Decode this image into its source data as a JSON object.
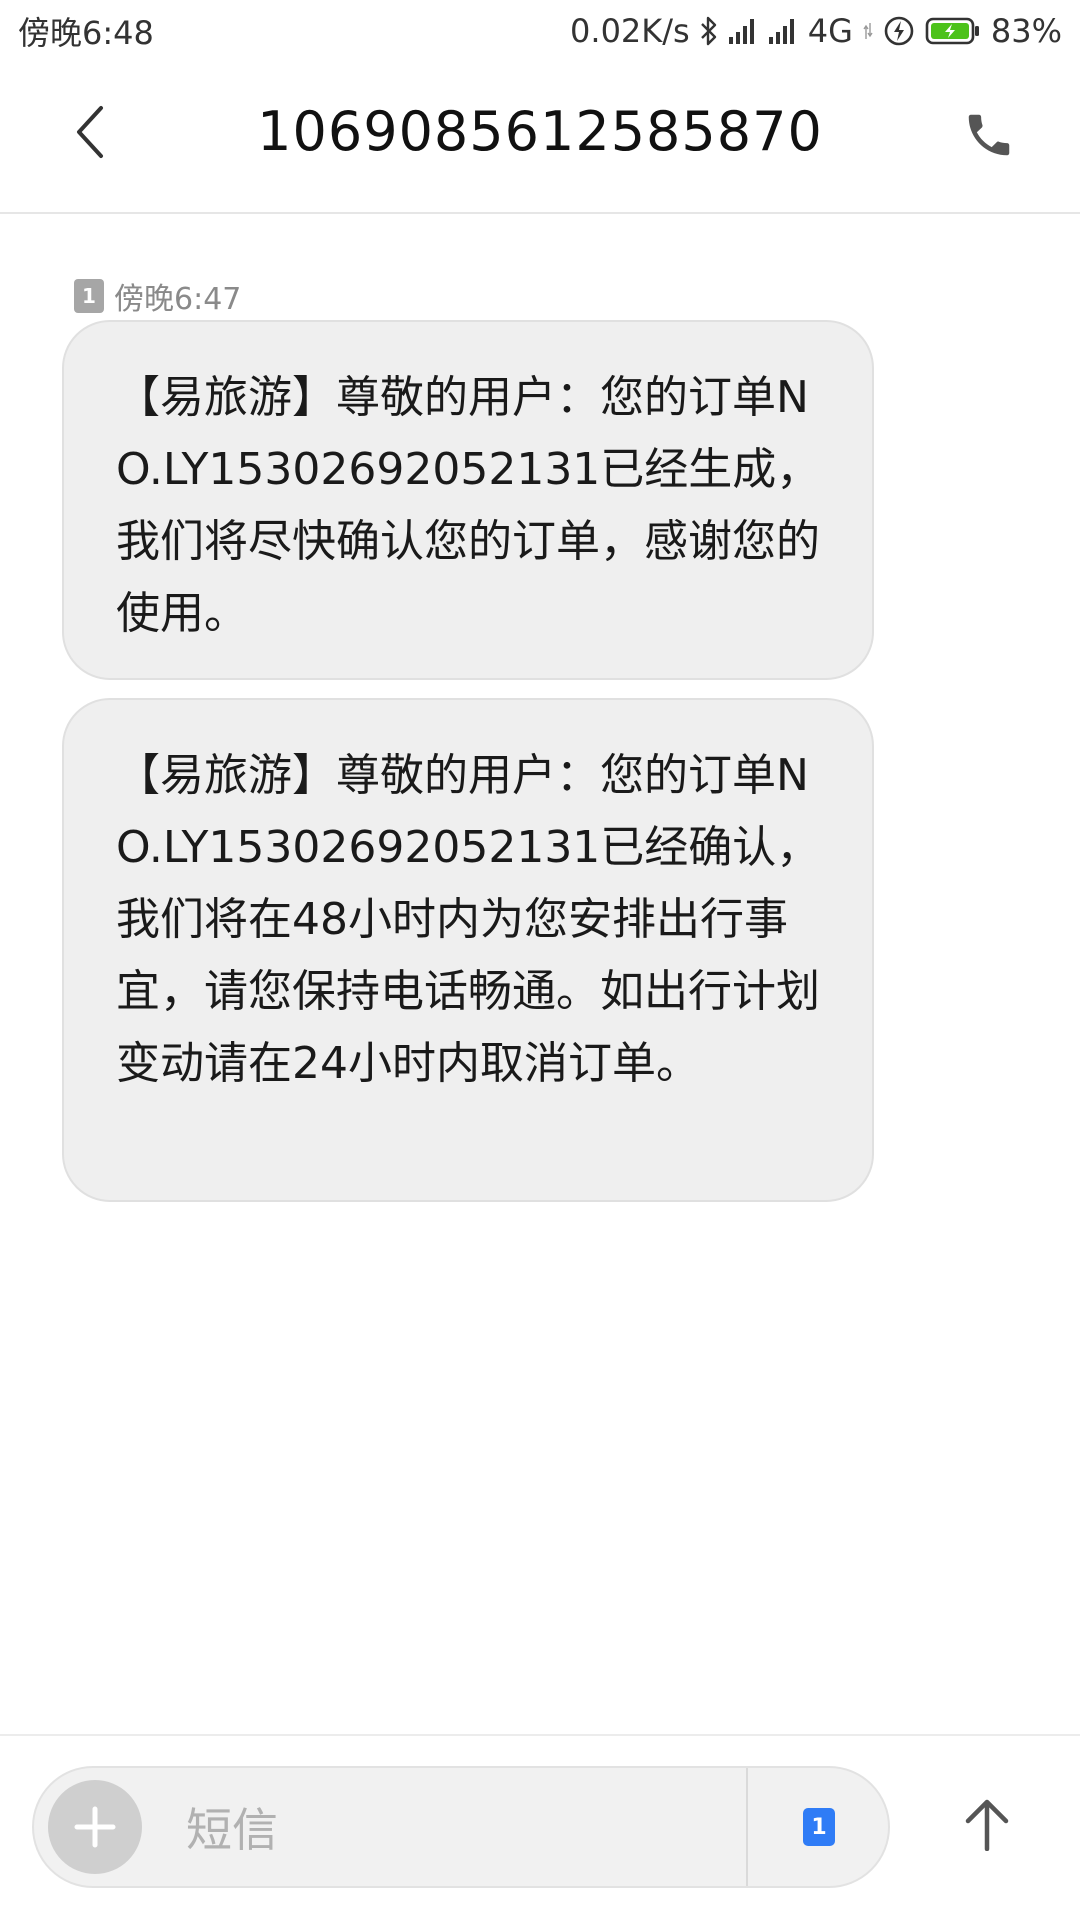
{
  "status_bar": {
    "time": "傍晚6:48",
    "network_speed": "0.02K/s",
    "network_type": "4G",
    "battery": "83%",
    "icons": [
      "bluetooth-icon",
      "signal-icon",
      "signal-icon",
      "data-arrows-icon",
      "charging-icon",
      "battery-icon"
    ]
  },
  "header": {
    "title": "1069085612585870",
    "back_icon": "chevron-left-icon",
    "call_icon": "phone-icon"
  },
  "conversation": {
    "timestamp": "傍晚6:47",
    "sim_label": "1",
    "messages": [
      {
        "text": "【易旅游】尊敬的用户：您的订单NO.LY15302692052131已经生成，我们将尽快确认您的订单，感谢您的使用。"
      },
      {
        "text": "【易旅游】尊敬的用户：您的订单NO.LY15302692052131已经确认，我们将在48小时内为您安排出行事宜，请您保持电话畅通。如出行计划变动请在24小时内取消订单。"
      }
    ]
  },
  "composer": {
    "placeholder": "短信",
    "sim_label": "1",
    "add_icon": "plus-icon",
    "send_icon": "arrow-up-icon"
  },
  "colors": {
    "bubble_bg": "#efefef",
    "sim_blue": "#2f7cf6",
    "battery_green": "#4cc21a"
  }
}
